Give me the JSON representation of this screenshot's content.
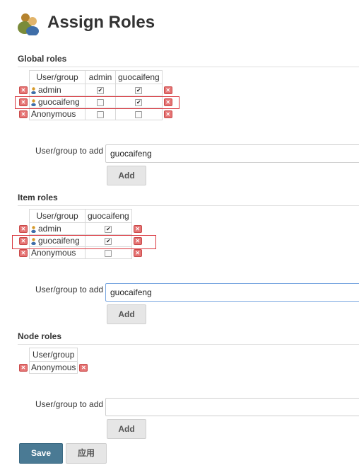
{
  "page": {
    "title": "Assign Roles"
  },
  "global_roles": {
    "title": "Global roles",
    "columns": [
      "User/group",
      "admin",
      "guocaifeng"
    ],
    "rows": [
      {
        "name": "admin",
        "icon": "user-icon",
        "checks": [
          true,
          true
        ]
      },
      {
        "name": "guocaifeng",
        "icon": "user-icon",
        "checks": [
          false,
          true
        ]
      },
      {
        "name": "Anonymous",
        "icon": "",
        "checks": [
          false,
          false
        ]
      }
    ],
    "add_label": "User/group to add",
    "add_value": "guocaifeng",
    "add_button": "Add"
  },
  "item_roles": {
    "title": "Item roles",
    "columns": [
      "User/group",
      "guocaifeng"
    ],
    "rows": [
      {
        "name": "admin",
        "icon": "user-icon",
        "checks": [
          true
        ]
      },
      {
        "name": "guocaifeng",
        "icon": "user-icon",
        "checks": [
          true
        ]
      },
      {
        "name": "Anonymous",
        "icon": "",
        "checks": [
          false
        ]
      }
    ],
    "add_label": "User/group to add",
    "add_value": "guocaifeng",
    "add_button": "Add"
  },
  "node_roles": {
    "title": "Node roles",
    "columns": [
      "User/group"
    ],
    "rows": [
      {
        "name": "Anonymous",
        "icon": ""
      }
    ],
    "add_label": "User/group to add",
    "add_value": "",
    "add_button": "Add"
  },
  "actions": {
    "save": "Save",
    "apply": "应用"
  },
  "colors": {
    "highlight": "#d9363e",
    "save_bg": "#4a7a94",
    "delete": "#e57373"
  }
}
